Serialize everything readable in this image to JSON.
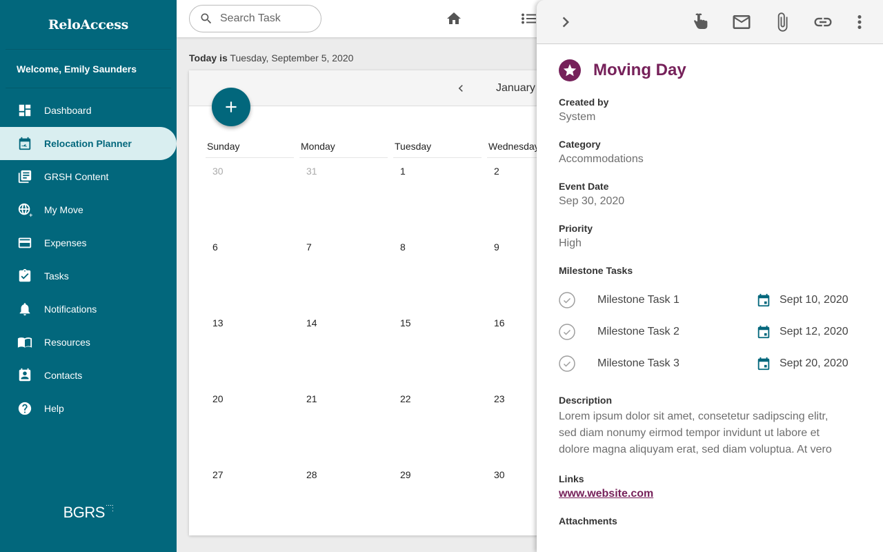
{
  "app": {
    "title": "ReloAccess",
    "welcome": "Welcome, Emily Saunders",
    "footer_logo": "BGRS"
  },
  "sidebar": {
    "items": [
      {
        "label": "Dashboard",
        "icon": "dashboard-icon",
        "active": false
      },
      {
        "label": "Relocation Planner",
        "icon": "calendar-flight-icon",
        "active": true
      },
      {
        "label": "GRSH Content",
        "icon": "library-books-icon",
        "active": false
      },
      {
        "label": "My Move",
        "icon": "globe-icon",
        "active": false
      },
      {
        "label": "Expenses",
        "icon": "credit-card-icon",
        "active": false
      },
      {
        "label": "Tasks",
        "icon": "clipboard-check-icon",
        "active": false
      },
      {
        "label": "Notifications",
        "icon": "bell-icon",
        "active": false
      },
      {
        "label": "Resources",
        "icon": "book-icon",
        "active": false
      },
      {
        "label": "Contacts",
        "icon": "contact-card-icon",
        "active": false
      },
      {
        "label": "Help",
        "icon": "help-icon",
        "active": false
      }
    ]
  },
  "topbar": {
    "search_placeholder": "Search Task",
    "search_value": ""
  },
  "main": {
    "today_prefix": "Today is",
    "today_value": "Tuesday, September 5, 2020",
    "calendar": {
      "month_label": "January",
      "weekdays": [
        "Sunday",
        "Monday",
        "Tuesday",
        "Wednesday"
      ],
      "weeks": [
        [
          {
            "d": "30",
            "muted": true
          },
          {
            "d": "31",
            "muted": true
          },
          {
            "d": "1"
          },
          {
            "d": "2"
          }
        ],
        [
          {
            "d": "6"
          },
          {
            "d": "7"
          },
          {
            "d": "8"
          },
          {
            "d": "9"
          }
        ],
        [
          {
            "d": "13"
          },
          {
            "d": "14"
          },
          {
            "d": "15"
          },
          {
            "d": "16"
          }
        ],
        [
          {
            "d": "20"
          },
          {
            "d": "21"
          },
          {
            "d": "22"
          },
          {
            "d": "23"
          }
        ],
        [
          {
            "d": "27"
          },
          {
            "d": "28"
          },
          {
            "d": "29"
          },
          {
            "d": "30"
          }
        ]
      ]
    }
  },
  "detail": {
    "title": "Moving Day",
    "accent_color": "#76215a",
    "fields": {
      "created_by": {
        "label": "Created by",
        "value": "System"
      },
      "category": {
        "label": "Category",
        "value": "Accommodations"
      },
      "event_date": {
        "label": "Event Date",
        "value": "Sep 30, 2020"
      },
      "priority": {
        "label": "Priority",
        "value": "High"
      }
    },
    "milestones_label": "Milestone Tasks",
    "milestones": [
      {
        "name": "Milestone Task 1",
        "date": "Sept 10, 2020"
      },
      {
        "name": "Milestone Task 2",
        "date": "Sept 12, 2020"
      },
      {
        "name": "Milestone Task 3",
        "date": "Sept 20, 2020"
      }
    ],
    "description_label": "Description",
    "description": "Lorem ipsum dolor sit amet, consetetur sadipscing elitr, sed diam nonumy eirmod tempor invidunt ut labore et dolore magna aliquyam erat, sed diam voluptua. At vero",
    "links_label": "Links",
    "link": "www.website.com",
    "attachments_label": "Attachments"
  },
  "colors": {
    "primary": "#02677c",
    "accent": "#76215a",
    "active_nav_bg": "#d9eef0"
  }
}
